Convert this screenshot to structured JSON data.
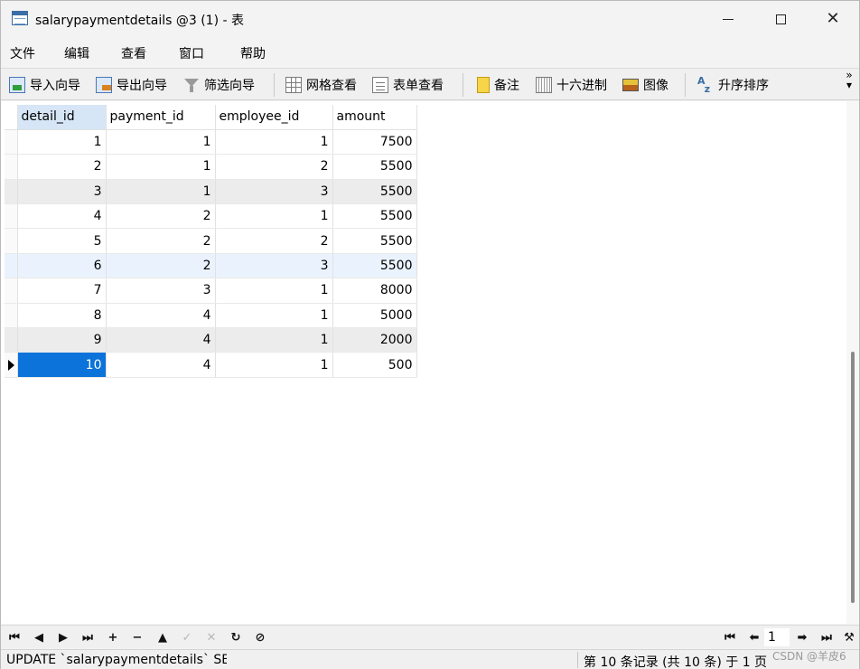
{
  "window": {
    "title": "salarypaymentdetails @3 (1) - 表"
  },
  "menu": [
    "文件",
    "编辑",
    "查看",
    "窗口",
    "帮助"
  ],
  "toolbar": {
    "import_wizard": "导入向导",
    "export_wizard": "导出向导",
    "filter_wizard": "筛选向导",
    "grid_view": "网格查看",
    "form_view": "表单查看",
    "memo": "备注",
    "hex": "十六进制",
    "image": "图像",
    "sort_asc": "升序排序"
  },
  "grid": {
    "columns": [
      "detail_id",
      "payment_id",
      "employee_id",
      "amount"
    ],
    "rows": [
      [
        "1",
        "1",
        "1",
        "7500"
      ],
      [
        "2",
        "1",
        "2",
        "5500"
      ],
      [
        "3",
        "1",
        "3",
        "5500"
      ],
      [
        "4",
        "2",
        "1",
        "5500"
      ],
      [
        "5",
        "2",
        "2",
        "5500"
      ],
      [
        "6",
        "2",
        "3",
        "5500"
      ],
      [
        "7",
        "3",
        "1",
        "8000"
      ],
      [
        "8",
        "4",
        "1",
        "5000"
      ],
      [
        "9",
        "4",
        "1",
        "2000"
      ],
      [
        "10",
        "4",
        "1",
        "500"
      ]
    ],
    "selected_row": 9
  },
  "nav": {
    "page": "1"
  },
  "status": {
    "sql": "UPDATE `salarypaymentdetails` SET",
    "record_info": "第 10 条记录 (共 10 条) 于 1 页"
  },
  "watermark": "CSDN @羊皮6",
  "colors": {
    "selection": "#0b73d9",
    "header_highlight": "#d7e6f7"
  }
}
